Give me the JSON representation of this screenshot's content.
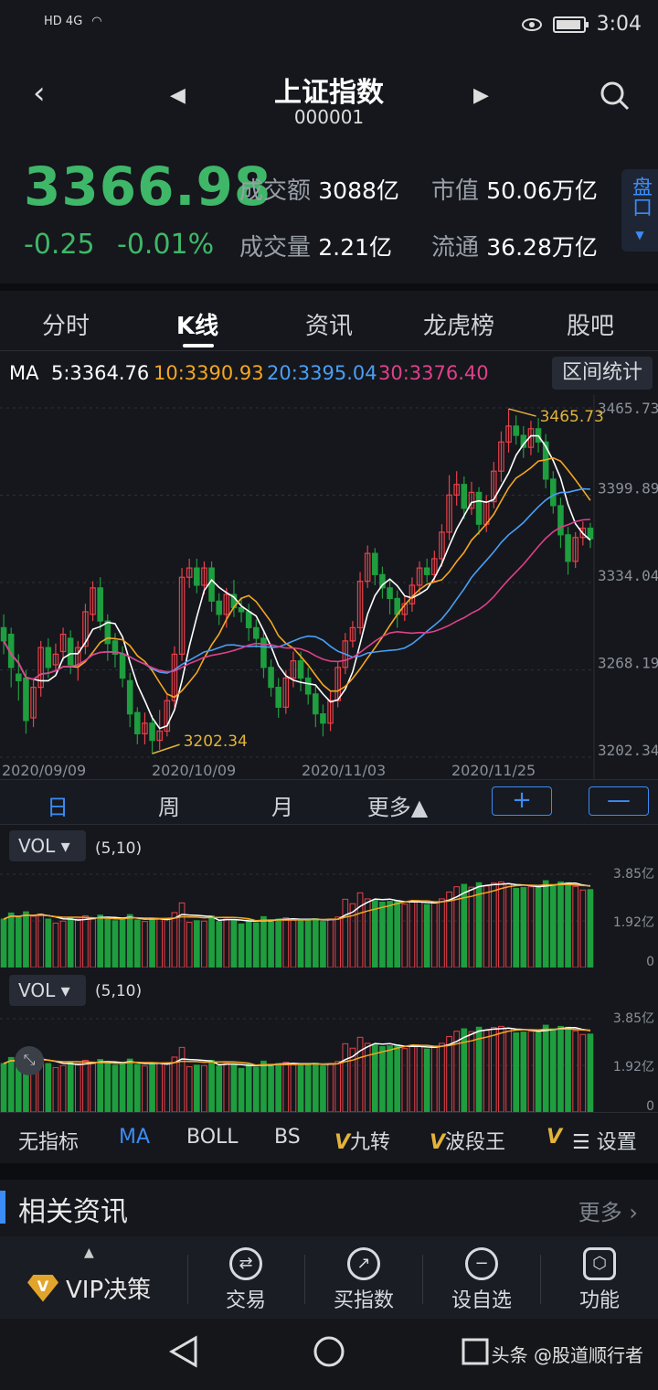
{
  "status": {
    "time": "3:04",
    "left_icons": "HD 4G"
  },
  "header": {
    "title": "上证指数",
    "code": "000001"
  },
  "quote": {
    "price": "3366.98",
    "change": "-0.25",
    "change_pct": "-0.01%",
    "turnover_label": "成交额",
    "turnover": "3088亿",
    "volume_label": "成交量",
    "volume": "2.21亿",
    "mktcap_label": "市值",
    "mktcap": "50.06万亿",
    "float_label": "流通",
    "float": "36.28万亿",
    "pankou": "盘口"
  },
  "tabs": [
    "分时",
    "K线",
    "资讯",
    "龙虎榜",
    "股吧"
  ],
  "ma": {
    "label": "MA",
    "ma5": "5:3364.76",
    "ma10": "10:3390.93",
    "ma20": "20:3395.04",
    "ma30": "30:3376.40",
    "range_stat": "区间统计"
  },
  "colors": {
    "up": "#e8404a",
    "down": "#1e9e3e",
    "ma5": "#ffffff",
    "ma10": "#f5a623",
    "ma20": "#4a9ff5",
    "ma30": "#e0408a",
    "accent": "#3b8cf7"
  },
  "chart_data": {
    "type": "candlestick",
    "y_ticks": [
      "3465.73",
      "3399.89",
      "3334.04",
      "3268.19",
      "3202.34"
    ],
    "x_ticks": [
      "2020/09/09",
      "2020/10/09",
      "2020/11/03",
      "2020/11/25"
    ],
    "ylim": [
      3202.34,
      3465.73
    ],
    "annotations": {
      "high": "3465.73",
      "low": "3202.34"
    },
    "candles": [
      [
        3300,
        3290,
        3310,
        3280
      ],
      [
        3295,
        3270,
        3300,
        3255
      ],
      [
        3265,
        3260,
        3280,
        3245
      ],
      [
        3262,
        3230,
        3268,
        3220
      ],
      [
        3232,
        3255,
        3262,
        3225
      ],
      [
        3255,
        3285,
        3290,
        3248
      ],
      [
        3285,
        3270,
        3292,
        3262
      ],
      [
        3272,
        3280,
        3288,
        3268
      ],
      [
        3282,
        3295,
        3300,
        3275
      ],
      [
        3292,
        3272,
        3298,
        3265
      ],
      [
        3272,
        3285,
        3290,
        3260
      ],
      [
        3286,
        3312,
        3318,
        3280
      ],
      [
        3310,
        3330,
        3335,
        3305
      ],
      [
        3330,
        3305,
        3338,
        3298
      ],
      [
        3305,
        3288,
        3310,
        3275
      ],
      [
        3290,
        3280,
        3296,
        3270
      ],
      [
        3280,
        3262,
        3286,
        3255
      ],
      [
        3260,
        3235,
        3266,
        3225
      ],
      [
        3236,
        3220,
        3240,
        3212
      ],
      [
        3220,
        3228,
        3236,
        3212
      ],
      [
        3228,
        3215,
        3234,
        3205
      ],
      [
        3215,
        3222,
        3238,
        3208
      ],
      [
        3222,
        3245,
        3250,
        3218
      ],
      [
        3245,
        3280,
        3286,
        3240
      ],
      [
        3280,
        3338,
        3345,
        3275
      ],
      [
        3338,
        3345,
        3352,
        3330
      ],
      [
        3345,
        3332,
        3352,
        3326
      ],
      [
        3332,
        3345,
        3350,
        3325
      ],
      [
        3345,
        3320,
        3350,
        3312
      ],
      [
        3320,
        3310,
        3326,
        3302
      ],
      [
        3310,
        3325,
        3330,
        3300
      ],
      [
        3325,
        3315,
        3336,
        3308
      ],
      [
        3315,
        3312,
        3322,
        3304
      ],
      [
        3312,
        3300,
        3318,
        3290
      ],
      [
        3300,
        3292,
        3306,
        3285
      ],
      [
        3292,
        3270,
        3298,
        3262
      ],
      [
        3270,
        3255,
        3276,
        3248
      ],
      [
        3255,
        3240,
        3262,
        3232
      ],
      [
        3240,
        3262,
        3268,
        3235
      ],
      [
        3262,
        3275,
        3282,
        3255
      ],
      [
        3275,
        3262,
        3282,
        3252
      ],
      [
        3262,
        3250,
        3270,
        3242
      ],
      [
        3250,
        3235,
        3256,
        3225
      ],
      [
        3235,
        3228,
        3242,
        3218
      ],
      [
        3228,
        3245,
        3252,
        3222
      ],
      [
        3245,
        3270,
        3275,
        3240
      ],
      [
        3270,
        3290,
        3296,
        3265
      ],
      [
        3290,
        3300,
        3305,
        3285
      ],
      [
        3300,
        3335,
        3342,
        3295
      ],
      [
        3335,
        3356,
        3362,
        3330
      ],
      [
        3356,
        3340,
        3360,
        3332
      ],
      [
        3340,
        3330,
        3346,
        3322
      ],
      [
        3330,
        3322,
        3336,
        3310
      ],
      [
        3322,
        3310,
        3328,
        3300
      ],
      [
        3310,
        3318,
        3324,
        3305
      ],
      [
        3318,
        3332,
        3338,
        3312
      ],
      [
        3332,
        3345,
        3350,
        3326
      ],
      [
        3345,
        3340,
        3352,
        3334
      ],
      [
        3340,
        3352,
        3358,
        3335
      ],
      [
        3352,
        3372,
        3378,
        3346
      ],
      [
        3372,
        3400,
        3415,
        3366
      ],
      [
        3400,
        3408,
        3418,
        3392
      ],
      [
        3408,
        3390,
        3414,
        3382
      ],
      [
        3390,
        3402,
        3410,
        3385
      ],
      [
        3402,
        3378,
        3406,
        3370
      ],
      [
        3378,
        3395,
        3400,
        3372
      ],
      [
        3395,
        3418,
        3425,
        3390
      ],
      [
        3418,
        3440,
        3448,
        3410
      ],
      [
        3440,
        3452,
        3465,
        3432
      ],
      [
        3452,
        3445,
        3460,
        3438
      ],
      [
        3445,
        3436,
        3452,
        3428
      ],
      [
        3436,
        3450,
        3456,
        3430
      ],
      [
        3450,
        3440,
        3458,
        3432
      ],
      [
        3440,
        3412,
        3446,
        3405
      ],
      [
        3412,
        3392,
        3418,
        3386
      ],
      [
        3392,
        3370,
        3398,
        3360
      ],
      [
        3370,
        3350,
        3376,
        3340
      ],
      [
        3350,
        3368,
        3372,
        3345
      ],
      [
        3368,
        3375,
        3380,
        3362
      ],
      [
        3375,
        3367,
        3379,
        3360
      ]
    ],
    "vol_ticks": [
      "3.85亿",
      "1.92亿",
      "0"
    ],
    "vol_params": "(5,10)"
  },
  "periods": {
    "day": "日",
    "week": "周",
    "month": "月",
    "more": "更多▲",
    "zoom_in": "+",
    "zoom_out": "—"
  },
  "vol": {
    "label": "VOL ▾",
    "params": "(5,10)"
  },
  "indicators": {
    "none": "无指标",
    "ma": "MA",
    "boll": "BOLL",
    "bs": "BS",
    "nine": "九转",
    "wave": "波段王",
    "v": "V",
    "settings": "设置"
  },
  "news": {
    "title": "相关资讯",
    "more": "更多 ›"
  },
  "bottom": {
    "vip": "VIP决策",
    "trade": "交易",
    "buy_index": "买指数",
    "watch": "设自选",
    "func": "功能"
  },
  "watermark": "头条 @股道顺行者"
}
